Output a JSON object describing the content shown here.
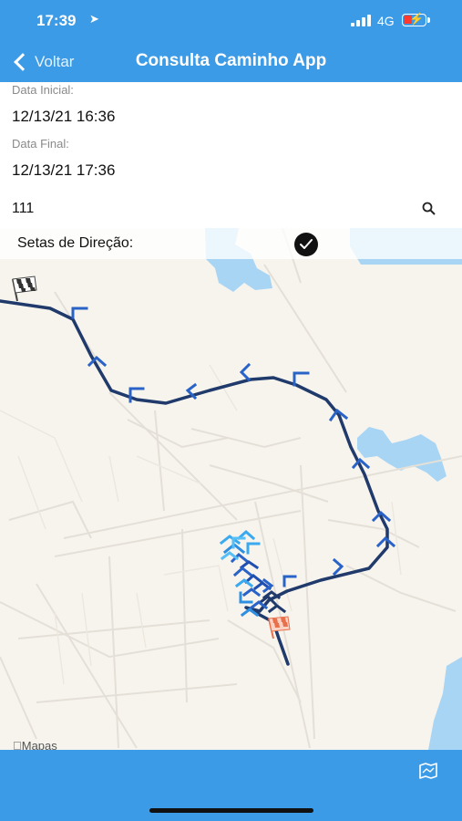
{
  "status_bar": {
    "time": "17:39",
    "location_icon": "location-arrow-icon",
    "network": "4G",
    "battery_icon": "battery-charging-icon"
  },
  "nav": {
    "back_label": "Voltar",
    "title": "Consulta Caminho App"
  },
  "form": {
    "start_label": "Data Inicial:",
    "start_value": "12/13/21 16:36",
    "end_label": "Data Final:",
    "end_value": "12/13/21 17:36",
    "search_value": "111",
    "search_icon": "search-icon"
  },
  "map": {
    "arrows_label": "Setas de Direção:",
    "arrows_enabled": true,
    "attribution": "Mapas",
    "start_marker": "checkered-flag-icon",
    "end_marker": "orange-checkered-flag-icon",
    "route_color": "#1f3a6b",
    "arrow_color": "#2a63c8",
    "cluster_color": "#3aaaf0",
    "water_color": "#a9d5f5"
  },
  "footer": {
    "map_button_icon": "map-icon"
  }
}
